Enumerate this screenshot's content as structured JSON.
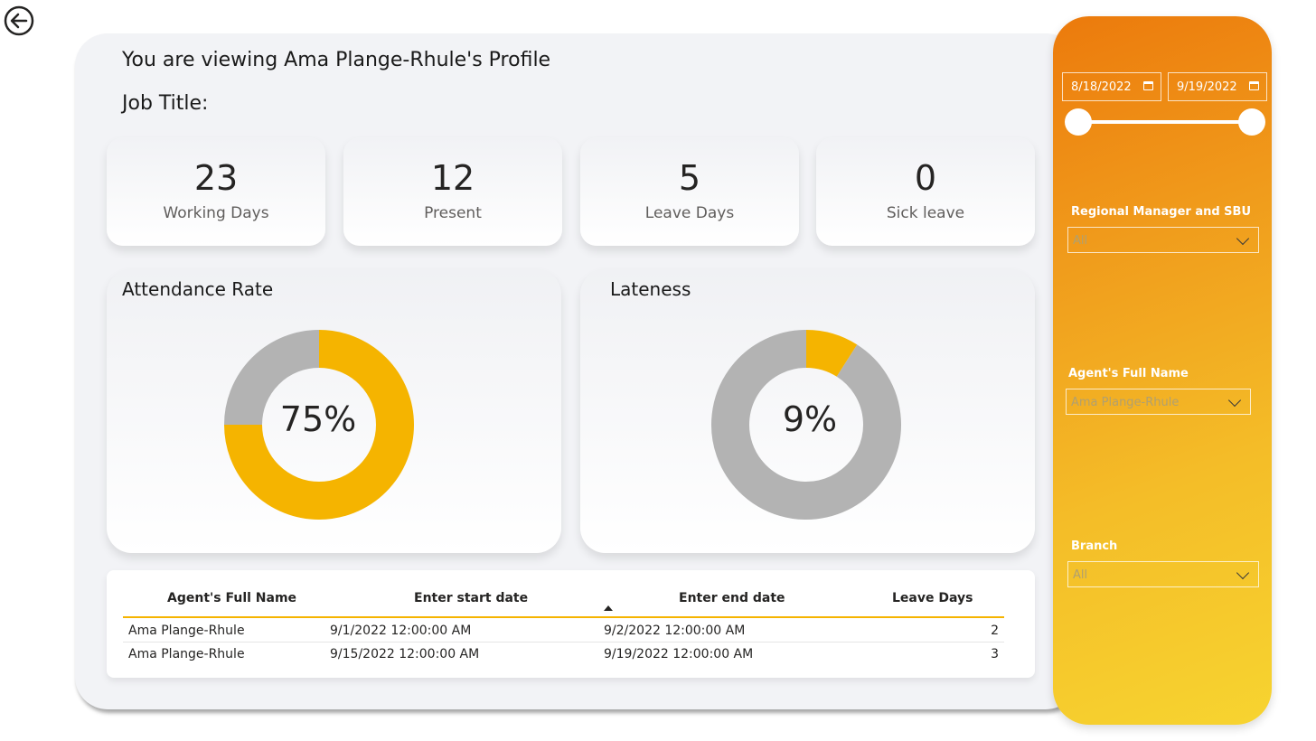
{
  "header": {
    "profile_title": "You are viewing Ama Plange-Rhule's Profile",
    "job_title_label": "Job Title:"
  },
  "kpis": [
    {
      "value": "23",
      "label": "Working Days"
    },
    {
      "value": "12",
      "label": "Present"
    },
    {
      "value": "5",
      "label": "Leave Days"
    },
    {
      "value": "0",
      "label": "Sick leave"
    }
  ],
  "charts": {
    "attendance": {
      "title": "Attendance Rate",
      "center_label": "75%"
    },
    "lateness": {
      "title": "Lateness",
      "center_label": "9%"
    }
  },
  "chart_data": [
    {
      "type": "pie",
      "title": "Attendance Rate",
      "donut": true,
      "slices": [
        {
          "value": 75,
          "color": "#f5b400"
        },
        {
          "value": 25,
          "color": "#b3b3b3"
        }
      ],
      "center_label": "75%"
    },
    {
      "type": "pie",
      "title": "Lateness",
      "donut": true,
      "slices": [
        {
          "value": 9,
          "color": "#f5b400"
        },
        {
          "value": 91,
          "color": "#b3b3b3"
        }
      ],
      "center_label": "9%"
    }
  ],
  "table": {
    "headers": [
      "Agent's Full Name",
      "Enter start date",
      "Enter end date",
      "Leave Days"
    ],
    "rows": [
      [
        "Ama  Plange-Rhule",
        "9/1/2022 12:00:00 AM",
        "9/2/2022 12:00:00 AM",
        "2"
      ],
      [
        "Ama  Plange-Rhule",
        "9/15/2022 12:00:00 AM",
        "9/19/2022 12:00:00 AM",
        "3"
      ]
    ]
  },
  "filters": {
    "start_date": "8/18/2022",
    "end_date": "9/19/2022",
    "regional_label": "Regional Manager and SBU",
    "regional_value": "All",
    "agent_label": "Agent's Full Name",
    "agent_value": "Ama Plange-Rhule",
    "branch_label": "Branch",
    "branch_value": "All"
  },
  "colors": {
    "accent": "#f5b400",
    "secondary": "#b3b3b3",
    "panel_gradient_start": "#ec7a0c",
    "panel_gradient_end": "#f7d430"
  }
}
